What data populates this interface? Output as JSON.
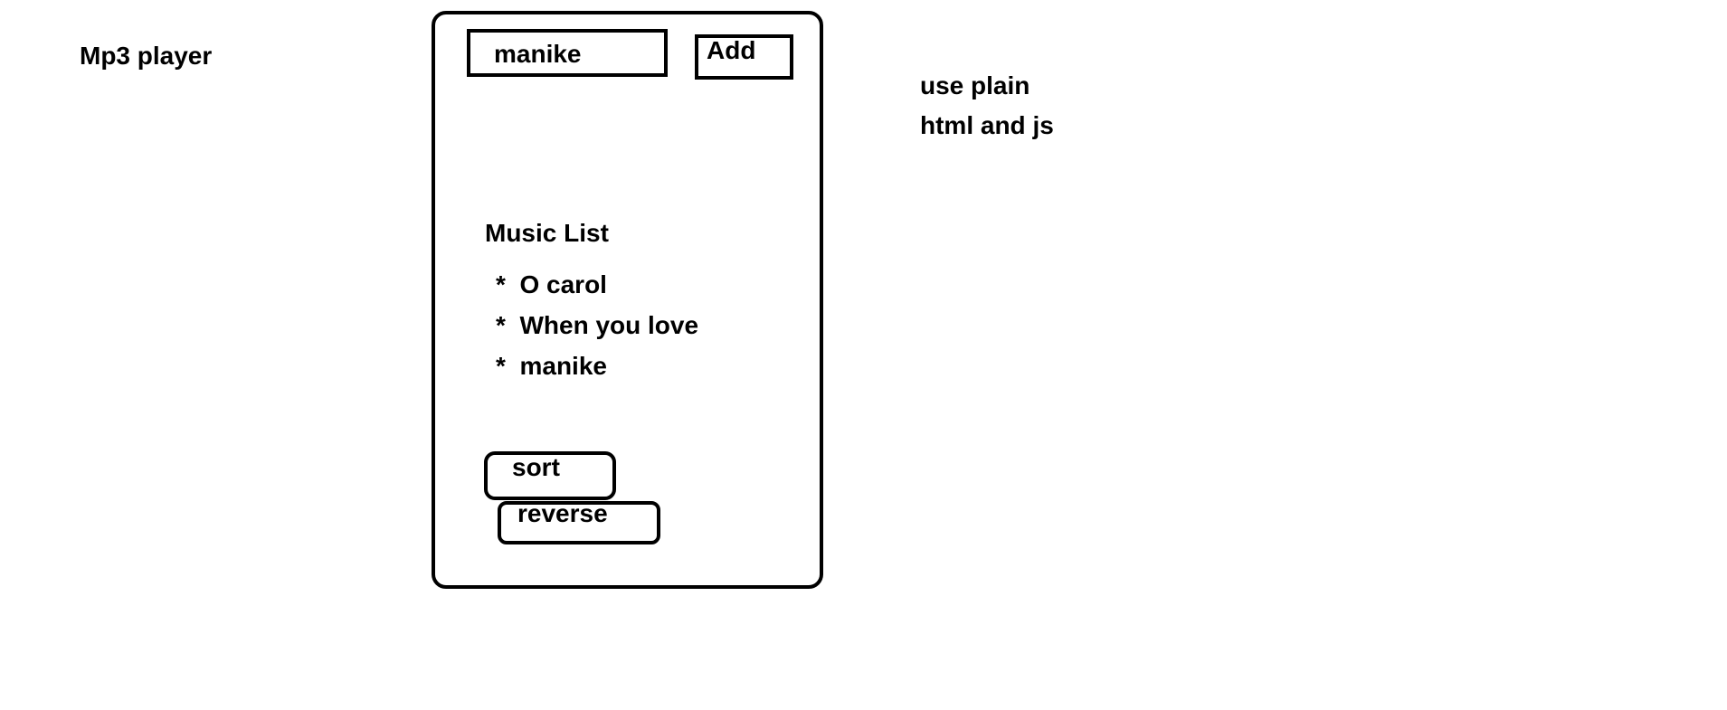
{
  "title": "Mp3 player",
  "input": {
    "value": "manike"
  },
  "add_label": "Add",
  "list": {
    "heading": "Music List",
    "bullet": "*",
    "items": [
      "O carol",
      "When you love",
      "manike"
    ]
  },
  "sort_label": "sort",
  "reverse_label": "reverse",
  "notes": [
    "use plain",
    "html and js"
  ]
}
